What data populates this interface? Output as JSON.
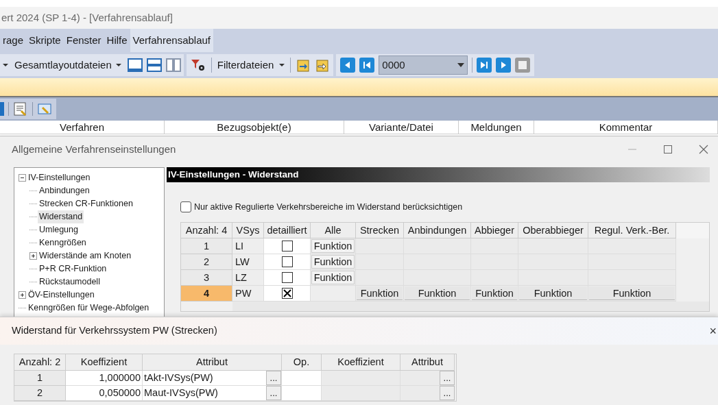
{
  "app": {
    "title": "ert 2024 (SP 1-4) - [Verfahrensablauf]",
    "menu": [
      {
        "label": "rage",
        "selected": false
      },
      {
        "label": "Skripte",
        "selected": false
      },
      {
        "label": "Fenster",
        "selected": false
      },
      {
        "label": "Hilfe",
        "selected": false
      },
      {
        "label": "Verfahrensablauf",
        "selected": true
      }
    ],
    "toolbar": {
      "layout_files": "Gesamtlayoutdateien",
      "filter_files": "Filterdateien",
      "counter": "0000"
    },
    "columns": [
      "Verfahren",
      "Bezugsobjekt(e)",
      "Variante/Datei",
      "Meldungen",
      "Kommentar"
    ]
  },
  "settings_dialog": {
    "title": "Allgemeine Verfahrenseinstellungen",
    "tree": [
      {
        "label": "IV-Einstellungen",
        "selected": false,
        "expanded": true,
        "children": [
          {
            "label": "Anbindungen",
            "selected": false
          },
          {
            "label": "Strecken CR-Funktionen",
            "selected": false
          },
          {
            "label": "Widerstand",
            "selected": true
          },
          {
            "label": "Umlegung",
            "selected": false
          },
          {
            "label": "Kenngrößen",
            "selected": false
          },
          {
            "label": "Widerstände am Knoten",
            "selected": false,
            "expanded": false
          },
          {
            "label": "P+R CR-Funktion",
            "selected": false
          },
          {
            "label": "Rückstaumodell",
            "selected": false
          }
        ]
      },
      {
        "label": "ÖV-Einstellungen",
        "selected": false,
        "expanded": false
      },
      {
        "label": "Kenngrößen für Wege-Abfolgen",
        "selected": false
      }
    ],
    "panel_title": "IV-Einstellungen - Widerstand",
    "option": {
      "label": "Nur aktive Regulierte Verkehrsbereiche im Widerstand berücksichtigen",
      "checked": false
    },
    "table": {
      "columns": [
        "Anzahl: 4",
        "VSys",
        "detailliert",
        "Alle",
        "Strecken",
        "Anbindungen",
        "Abbieger",
        "Oberabbieger",
        "Regul. Verk.-Ber."
      ],
      "rows": [
        {
          "index": "1",
          "vsys": "LI",
          "detailed": false,
          "selected": false,
          "alle": "Funktion"
        },
        {
          "index": "2",
          "vsys": "LW",
          "detailed": false,
          "selected": false,
          "alle": "Funktion"
        },
        {
          "index": "3",
          "vsys": "LZ",
          "detailed": false,
          "selected": false,
          "alle": "Funktion"
        },
        {
          "index": "4",
          "vsys": "PW",
          "detailed": true,
          "selected": true,
          "per_type": [
            "Funktion",
            "Funktion",
            "Funktion",
            "Funktion",
            "Funktion"
          ]
        }
      ]
    }
  },
  "resistance_dialog": {
    "title": "Widerstand für Verkehrssystem PW (Strecken)",
    "close": "×",
    "table": {
      "columns": [
        "Anzahl: 2",
        "Koeffizient",
        "Attribut",
        "Op.",
        "Koeffizient",
        "Attribut"
      ],
      "rows": [
        {
          "index": "1",
          "coefficient": "1,000000",
          "attribute": "tAkt-IVSys(PW)",
          "browse": "...",
          "browse_2": "..."
        },
        {
          "index": "2",
          "coefficient": "0,050000",
          "attribute": "Maut-IVSys(PW)",
          "browse": "...",
          "browse_2": "..."
        }
      ]
    }
  }
}
